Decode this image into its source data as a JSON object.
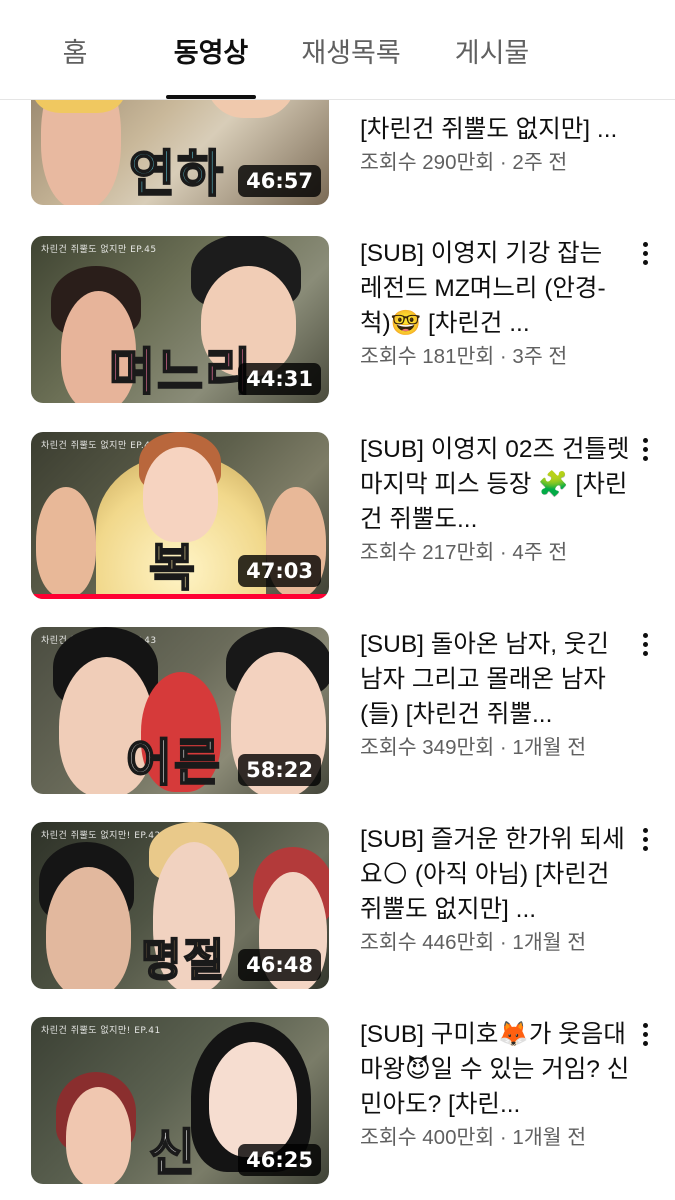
{
  "tabs": [
    {
      "label": "홈"
    },
    {
      "label": "동영상"
    },
    {
      "label": "재생목록"
    },
    {
      "label": "게시물"
    }
  ],
  "active_tab": "동영상",
  "videos": [
    {
      "thumb_title": "연하",
      "thumb_ep": "",
      "duration": "46:57",
      "title": "[차린건 쥐뿔도 없지만] ...",
      "meta": "조회수 290만회 · 2주 전",
      "watched_fraction": 0,
      "colors": {
        "bg": "#a88f6e",
        "accent": "#5fc6d8"
      }
    },
    {
      "thumb_title": "며느리",
      "thumb_ep": "차린건 쥐뿔도 없지만 EP.45",
      "duration": "44:31",
      "title": "[SUB] 이영지 기강 잡는 레전드 MZ며느리 (안경-척)🤓 [차린건 ...",
      "meta": "조회수 181만회 · 3주 전",
      "watched_fraction": 0,
      "colors": {
        "bg": "#5b6046",
        "accent": "#ff7aa8"
      }
    },
    {
      "thumb_title": "복",
      "thumb_ep": "차린건 쥐뿔도 없지만 EP.44",
      "duration": "47:03",
      "title": "[SUB] 이영지 02즈 건틀렛 마지막 피스 등장 🧩 [차린건 쥐뿔도...",
      "meta": "조회수 217만회 · 4주 전",
      "watched_fraction": 1,
      "colors": {
        "bg": "#4a4d3c",
        "accent": "#fbe7a1"
      }
    },
    {
      "thumb_title": "어른",
      "thumb_ep": "차린건 쥐뿔도 없지만 EP.43",
      "duration": "58:22",
      "title": "[SUB] 돌아온 남자, 웃긴 남자 그리고 몰래온 남자(들) [차린건 쥐뿔...",
      "meta": "조회수 349만회 · 1개월 전",
      "watched_fraction": 0,
      "colors": {
        "bg": "#55574a",
        "accent": "#6fcf6a"
      }
    },
    {
      "thumb_title": "명절",
      "thumb_ep": "차린건 쥐뿔도 없지만! EP.42",
      "duration": "46:48",
      "title": "[SUB] 즐거운 한가위 되세요🌕 (아직 아님) [차린건 쥐뿔도 없지만] ...",
      "meta": "조회수 446만회 · 1개월 전",
      "watched_fraction": 0,
      "colors": {
        "bg": "#3e4436",
        "accent": "#c9a06a"
      }
    },
    {
      "thumb_title": "신",
      "thumb_ep": "차린건 쥐뿔도 없지만! EP.41",
      "duration": "46:25",
      "title": "[SUB] 구미호🦊가 웃음대마왕😈일 수 있는 거임? 신민아도? [차린...",
      "meta": "조회수 400만회 · 1개월 전",
      "watched_fraction": 0,
      "colors": {
        "bg": "#4d5244",
        "accent": "#f2f2f2"
      }
    }
  ]
}
